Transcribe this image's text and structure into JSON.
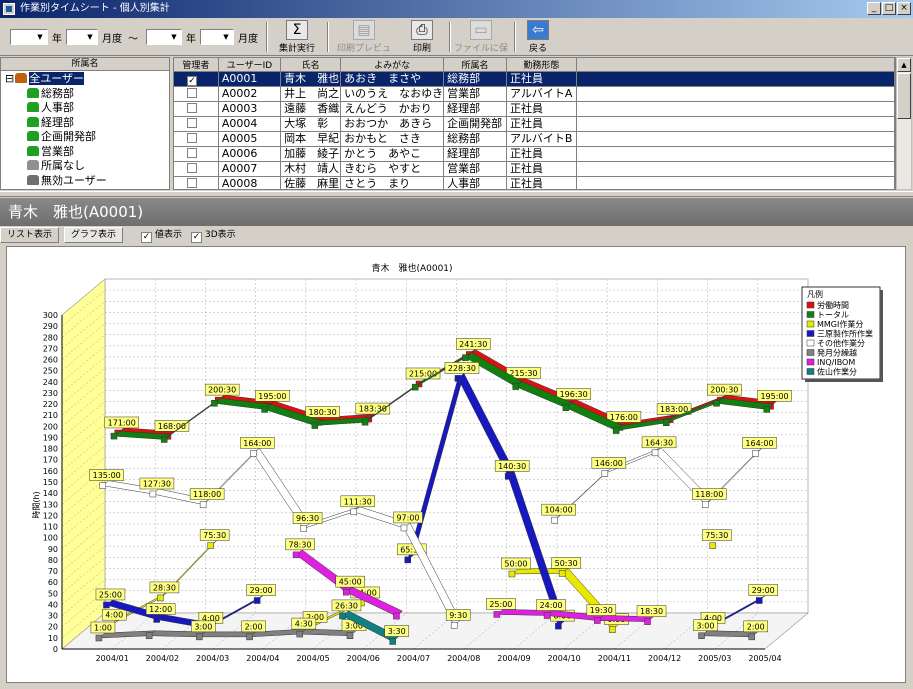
{
  "window": {
    "title": "作業別タイムシート - 個人別集計"
  },
  "toolbar": {
    "year_label_1": "年",
    "month_label_1": "月度",
    "tilde": "～",
    "year_label_2": "年",
    "month_label_2": "月度",
    "buttons": [
      {
        "label": "集計実行",
        "icon": "sigma-icon",
        "enabled": true
      },
      {
        "label": "印刷プレビュー",
        "icon": "print-preview-icon",
        "enabled": false
      },
      {
        "label": "印刷",
        "icon": "printer-icon",
        "enabled": true
      },
      {
        "label": "ファイルに保存",
        "icon": "save-file-icon",
        "enabled": false
      },
      {
        "label": "戻る",
        "icon": "exit-door-icon",
        "enabled": true
      }
    ]
  },
  "tree": {
    "header": "所属名",
    "items": [
      {
        "label": "全ユーザー",
        "level": 0,
        "selected": true,
        "icon": "users-group-icon"
      },
      {
        "label": "総務部",
        "level": 1,
        "icon": "dept-icon"
      },
      {
        "label": "人事部",
        "level": 1,
        "icon": "dept-icon"
      },
      {
        "label": "経理部",
        "level": 1,
        "icon": "dept-icon"
      },
      {
        "label": "企画開発部",
        "level": 1,
        "icon": "dept-icon"
      },
      {
        "label": "営業部",
        "level": 1,
        "icon": "dept-icon"
      },
      {
        "label": "所属なし",
        "level": 1,
        "icon": "gray-user-icon"
      },
      {
        "label": "無効ユーザー",
        "level": 1,
        "icon": "invalid-user-icon"
      }
    ]
  },
  "grid": {
    "headers": [
      "管理者",
      "ユーザーID",
      "氏名",
      "よみがな",
      "所属名",
      "勤務形態"
    ],
    "rows": [
      {
        "admin": true,
        "id": "A0001",
        "name": "青木　雅也",
        "kana": "あおき　まさや",
        "dept": "総務部",
        "type": "正社員",
        "selected": true
      },
      {
        "admin": false,
        "id": "A0002",
        "name": "井上　尚之",
        "kana": "いのうえ　なおゆき",
        "dept": "営業部",
        "type": "アルバイトA"
      },
      {
        "admin": false,
        "id": "A0003",
        "name": "遠藤　香織",
        "kana": "えんどう　かおり",
        "dept": "経理部",
        "type": "正社員"
      },
      {
        "admin": false,
        "id": "A0004",
        "name": "大塚　彰",
        "kana": "おおつか　あきら",
        "dept": "企画開発部",
        "type": "正社員"
      },
      {
        "admin": false,
        "id": "A0005",
        "name": "岡本　早紀",
        "kana": "おかもと　さき",
        "dept": "総務部",
        "type": "アルバイトB"
      },
      {
        "admin": false,
        "id": "A0006",
        "name": "加藤　綾子",
        "kana": "かとう　あやこ",
        "dept": "経理部",
        "type": "正社員"
      },
      {
        "admin": false,
        "id": "A0007",
        "name": "木村　靖人",
        "kana": "きむら　やすと",
        "dept": "営業部",
        "type": "正社員"
      },
      {
        "admin": false,
        "id": "A0008",
        "name": "佐藤　麻里",
        "kana": "さとう　まり",
        "dept": "人事部",
        "type": "正社員"
      }
    ]
  },
  "selected_user_title": "青木　雅也(A0001)",
  "view_tabs": {
    "list": "リスト表示",
    "graph": "グラフ表示",
    "active": "graph"
  },
  "options": {
    "show_values": "値表示",
    "show_values_checked": true,
    "show_3d": "3D表示",
    "show_3d_checked": true
  },
  "colors": {
    "titlebar": "#0a246a",
    "selection": "#0a246a",
    "wall": "#ffff99"
  },
  "chart_data": {
    "type": "line",
    "title": "青木　雅也(A0001)",
    "ylabel": "時間(h)",
    "ylim": [
      0,
      300
    ],
    "ytick_step": 10,
    "categories": [
      "2004/01",
      "2004/02",
      "2004/03",
      "2004/04",
      "2004/05",
      "2004/06",
      "2004/07",
      "2004/08",
      "2004/09",
      "2004/10",
      "2004/11",
      "2004/12",
      "2005/03",
      "2005/04"
    ],
    "legend_title": "凡例",
    "legend_position": "top-right",
    "series": [
      {
        "name": "労働時間",
        "color": "#e01010",
        "values": [
          171,
          168,
          200.5,
          195,
          180.5,
          183.5,
          215,
          241.5,
          215.5,
          196.5,
          176,
          183,
          200.5,
          195
        ],
        "labels": [
          "171:00",
          "168:00",
          "200:30",
          "195:00",
          "180:30",
          "183:30",
          "215:00",
          "241:30",
          "215:30",
          "196:30",
          "176:00",
          "183:00",
          "200:30",
          "195:00"
        ]
      },
      {
        "name": "トータル",
        "color": "#108010",
        "values": [
          171,
          168,
          200.5,
          195,
          180.5,
          183.5,
          215,
          241.5,
          215.5,
          196.5,
          176,
          183,
          200.5,
          195
        ],
        "labels": []
      },
      {
        "name": "MMGI作業分",
        "color": "#e8e800",
        "values": [
          4,
          28.5,
          75.5,
          null,
          2,
          24,
          null,
          null,
          50,
          50.5,
          0,
          null,
          75.5,
          null
        ],
        "labels": [
          "4:00",
          "28:30",
          "75:30",
          "",
          "2:00",
          "24:00",
          "",
          "",
          "50:00",
          "50:30",
          "0:00",
          "",
          "75:30",
          ""
        ]
      },
      {
        "name": "三原製作所作業",
        "color": "#1818c0",
        "values": [
          25,
          12,
          4,
          29,
          null,
          null,
          65.5,
          228.5,
          140.5,
          6,
          null,
          null,
          4,
          29
        ],
        "labels": [
          "25:00",
          "12:00",
          "4:00",
          "29:00",
          "",
          "",
          "65:30",
          "228:30",
          "140:30",
          "6:00",
          "",
          "",
          "4:00",
          "29:00"
        ]
      },
      {
        "name": "その他作業分",
        "color": "#ffffff",
        "values": [
          135,
          127.5,
          118,
          164,
          96.5,
          111.5,
          97,
          9.5,
          null,
          104,
          146,
          164.5,
          118,
          164
        ],
        "labels": [
          "135:00",
          "127:30",
          "118:00",
          "164:00",
          "96:30",
          "111:30",
          "97:00",
          "9:30",
          "",
          "104:00",
          "146:00",
          "164:30",
          "118:00",
          "164:00"
        ]
      },
      {
        "name": "発月分繰越",
        "color": "#808080",
        "values": [
          1,
          3,
          2,
          2,
          4.5,
          3,
          null,
          null,
          null,
          null,
          null,
          null,
          3,
          2
        ],
        "labels": [
          "1:00",
          "",
          "3:00",
          "2:00",
          "4:30",
          "3:00",
          "",
          "",
          "",
          "",
          "",
          "",
          "3:00",
          "2:00"
        ]
      },
      {
        "name": "INQ/IBOM",
        "color": "#e020e0",
        "values": [
          null,
          null,
          null,
          null,
          78.5,
          45,
          23.5,
          null,
          25,
          24,
          19.5,
          18.5,
          null,
          null
        ],
        "labels": [
          "",
          "",
          "",
          "",
          "78:30",
          "45:00",
          "",
          "",
          "25:00",
          "24:00",
          "19:30",
          "18:30",
          "",
          ""
        ]
      },
      {
        "name": "佐山作業分",
        "color": "#108080",
        "values": [
          null,
          null,
          null,
          null,
          null,
          26.5,
          3.5,
          null,
          null,
          null,
          null,
          null,
          null,
          null
        ],
        "labels": [
          "",
          "",
          "",
          "",
          "",
          "26:30",
          "3:30",
          "",
          "",
          "",
          "",
          "",
          "",
          ""
        ]
      }
    ]
  }
}
